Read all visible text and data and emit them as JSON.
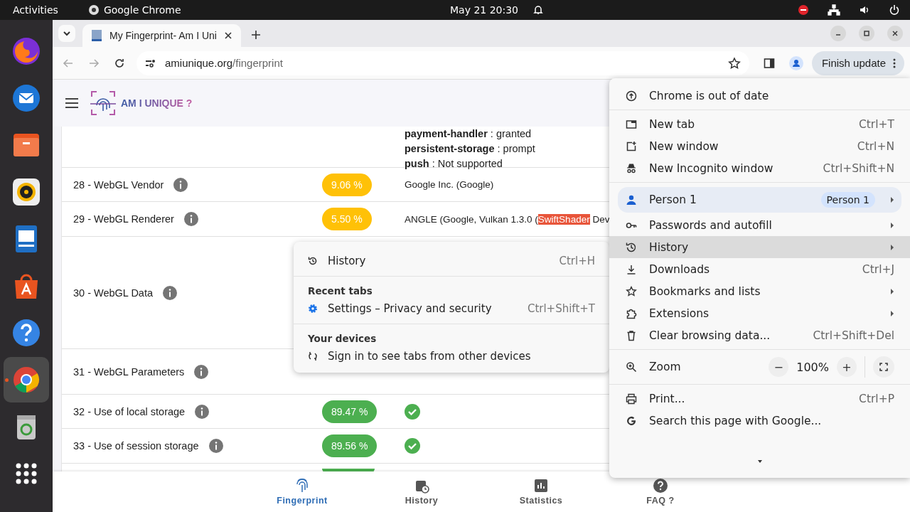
{
  "topbar": {
    "activities": "Activities",
    "app": "Google Chrome",
    "clock": "May 21  20:30"
  },
  "dock": [
    {
      "kind": "firefox",
      "running": false
    },
    {
      "kind": "mail",
      "running": false
    },
    {
      "kind": "files",
      "running": false
    },
    {
      "kind": "music",
      "running": false
    },
    {
      "kind": "writer",
      "running": false
    },
    {
      "kind": "store",
      "running": false
    },
    {
      "kind": "help",
      "running": false
    },
    {
      "kind": "chrome",
      "running": true
    },
    {
      "kind": "trash",
      "running": false
    },
    {
      "kind": "apps",
      "running": false
    }
  ],
  "tabs": [
    {
      "title": "My Fingerprint- Am I Uni",
      "selected": true
    }
  ],
  "address": {
    "host": "amiunique.org",
    "path": "/fingerprint"
  },
  "update_button": "Finish update",
  "site": {
    "logo": "AM I UNIQUE ?"
  },
  "permissions": [
    "**payment-handler** : granted",
    "**persistent-storage** : prompt",
    "**push** : Not supported"
  ],
  "rows": [
    {
      "label": "28 - WebGL Vendor",
      "badge": "9.06 %",
      "color": "#ffc107",
      "value": [
        {
          "text": "Google Inc. (Google)",
          "highlighted": false
        }
      ]
    },
    {
      "label": "29 - WebGL Renderer",
      "badge": "5.50 %",
      "color": "#ffc107",
      "value": [
        {
          "text": "ANGLE (Google, Vulkan 1.3.0 (",
          "highlighted": false
        },
        {
          "text": "SwiftShader",
          "highlighted": true
        },
        {
          "text": " Dev",
          "highlighted": false
        }
      ]
    },
    {
      "label": "30 - WebGL Data"
    },
    {
      "label": "31 - WebGL Parameters"
    },
    {
      "label": "32 - Use of local storage",
      "badge": "89.47 %",
      "color": "#4caf50",
      "check": true
    },
    {
      "label": "33 - Use of session storage",
      "badge": "89.56 %",
      "color": "#4caf50",
      "check": true
    }
  ],
  "bottom_nav": [
    {
      "label": "Fingerprint",
      "selected": true
    },
    {
      "label": "History",
      "selected": false
    },
    {
      "label": "Statistics",
      "selected": false
    },
    {
      "label": "FAQ ?",
      "selected": false
    }
  ],
  "menu": {
    "sections": [
      [
        {
          "kind": "update",
          "label": "Chrome is out of date"
        }
      ],
      [
        {
          "kind": "item",
          "label": "New tab",
          "shortcut": "Ctrl+T",
          "submenu": false,
          "selected": false
        },
        {
          "kind": "item",
          "label": "New window",
          "shortcut": "Ctrl+N",
          "submenu": false,
          "selected": false
        },
        {
          "kind": "item",
          "label": "New Incognito window",
          "shortcut": "Ctrl+Shift+N",
          "submenu": false,
          "selected": false
        }
      ],
      [
        {
          "kind": "profile",
          "label": "Person 1",
          "badge": "Person 1",
          "submenu": true
        },
        {
          "kind": "item",
          "label": "Passwords and autofill",
          "submenu": true,
          "selected": false
        },
        {
          "kind": "item",
          "label": "History",
          "submenu": true,
          "selected": true
        },
        {
          "kind": "item",
          "label": "Downloads",
          "shortcut": "Ctrl+J",
          "submenu": false,
          "selected": false
        },
        {
          "kind": "item",
          "label": "Bookmarks and lists",
          "submenu": true,
          "selected": false
        },
        {
          "kind": "item",
          "label": "Extensions",
          "submenu": true,
          "selected": false
        },
        {
          "kind": "item",
          "label": "Clear browsing data...",
          "shortcut": "Ctrl+Shift+Del",
          "submenu": false,
          "selected": false
        }
      ],
      [
        {
          "kind": "zoom",
          "label": "Zoom",
          "value": "100%",
          "minus": "−",
          "plus": "+"
        }
      ],
      [
        {
          "kind": "item",
          "label": "Print...",
          "shortcut": "Ctrl+P",
          "submenu": false,
          "selected": false
        },
        {
          "kind": "item",
          "label": "Search this page with Google...",
          "submenu": false,
          "selected": false
        }
      ]
    ]
  },
  "history_menu": {
    "sections": [
      {
        "items": [
          {
            "label": "History",
            "shortcut": "Ctrl+H"
          }
        ]
      },
      {
        "heading": "Recent tabs",
        "items": [
          {
            "label": "Settings – Privacy and security",
            "shortcut": "Ctrl+Shift+T"
          }
        ]
      },
      {
        "heading": "Your devices",
        "items": [
          {
            "label": "Sign in to see tabs from other devices"
          }
        ]
      }
    ]
  }
}
